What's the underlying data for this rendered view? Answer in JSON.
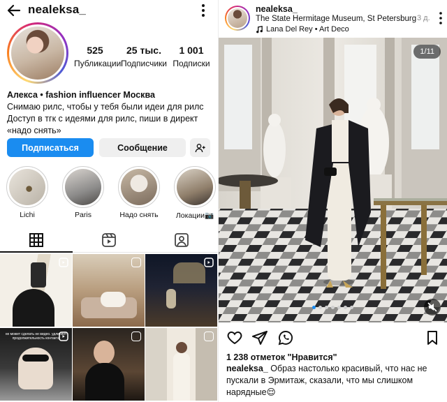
{
  "profile": {
    "username": "nealeksa_",
    "stats": [
      {
        "value": "525",
        "label": "Публикации"
      },
      {
        "value": "25 тыс.",
        "label": "Подписчики"
      },
      {
        "value": "1 001",
        "label": "Подписки"
      }
    ],
    "bio": {
      "name_line": "Алекса • fashion influencer Москва",
      "lines": [
        "Снимаю рилс, чтобы у тебя были идеи для рилс",
        "Доступ в тгк с идеями для рилс, пиши в директ",
        "«надо снять»"
      ]
    },
    "buttons": {
      "follow": "Подписаться",
      "message": "Сообщение"
    },
    "highlights": [
      {
        "label": "Lichi"
      },
      {
        "label": "Paris"
      },
      {
        "label": "Надо снять"
      },
      {
        "label": "Локации📷"
      }
    ],
    "tabs": [
      {
        "icon": "grid-icon"
      },
      {
        "icon": "reels-icon"
      },
      {
        "icon": "tagged-icon"
      }
    ],
    "grid_overlay_text": "не может сделать не видео. удлиняет продолжительность контакта"
  },
  "post": {
    "username": "nealeksa_",
    "location": "The State Hermitage Museum, St Petersburg",
    "music": "Lana Del Rey • Art Deco",
    "time": "3 д.",
    "counter": "1/11",
    "likes": "1 238 отметок \"Нравится\"",
    "caption_user": "nealeksa_",
    "caption_text": " Образ  настолько красивый, что нас не пускали в Эрмитаж, сказали, что мы слишком нарядные😌",
    "dots": {
      "count": 7,
      "active": 0
    }
  },
  "colors": {
    "accent": "#1a8cf0",
    "secondary_button": "#efefef",
    "muted_text": "#8e8e8e"
  }
}
